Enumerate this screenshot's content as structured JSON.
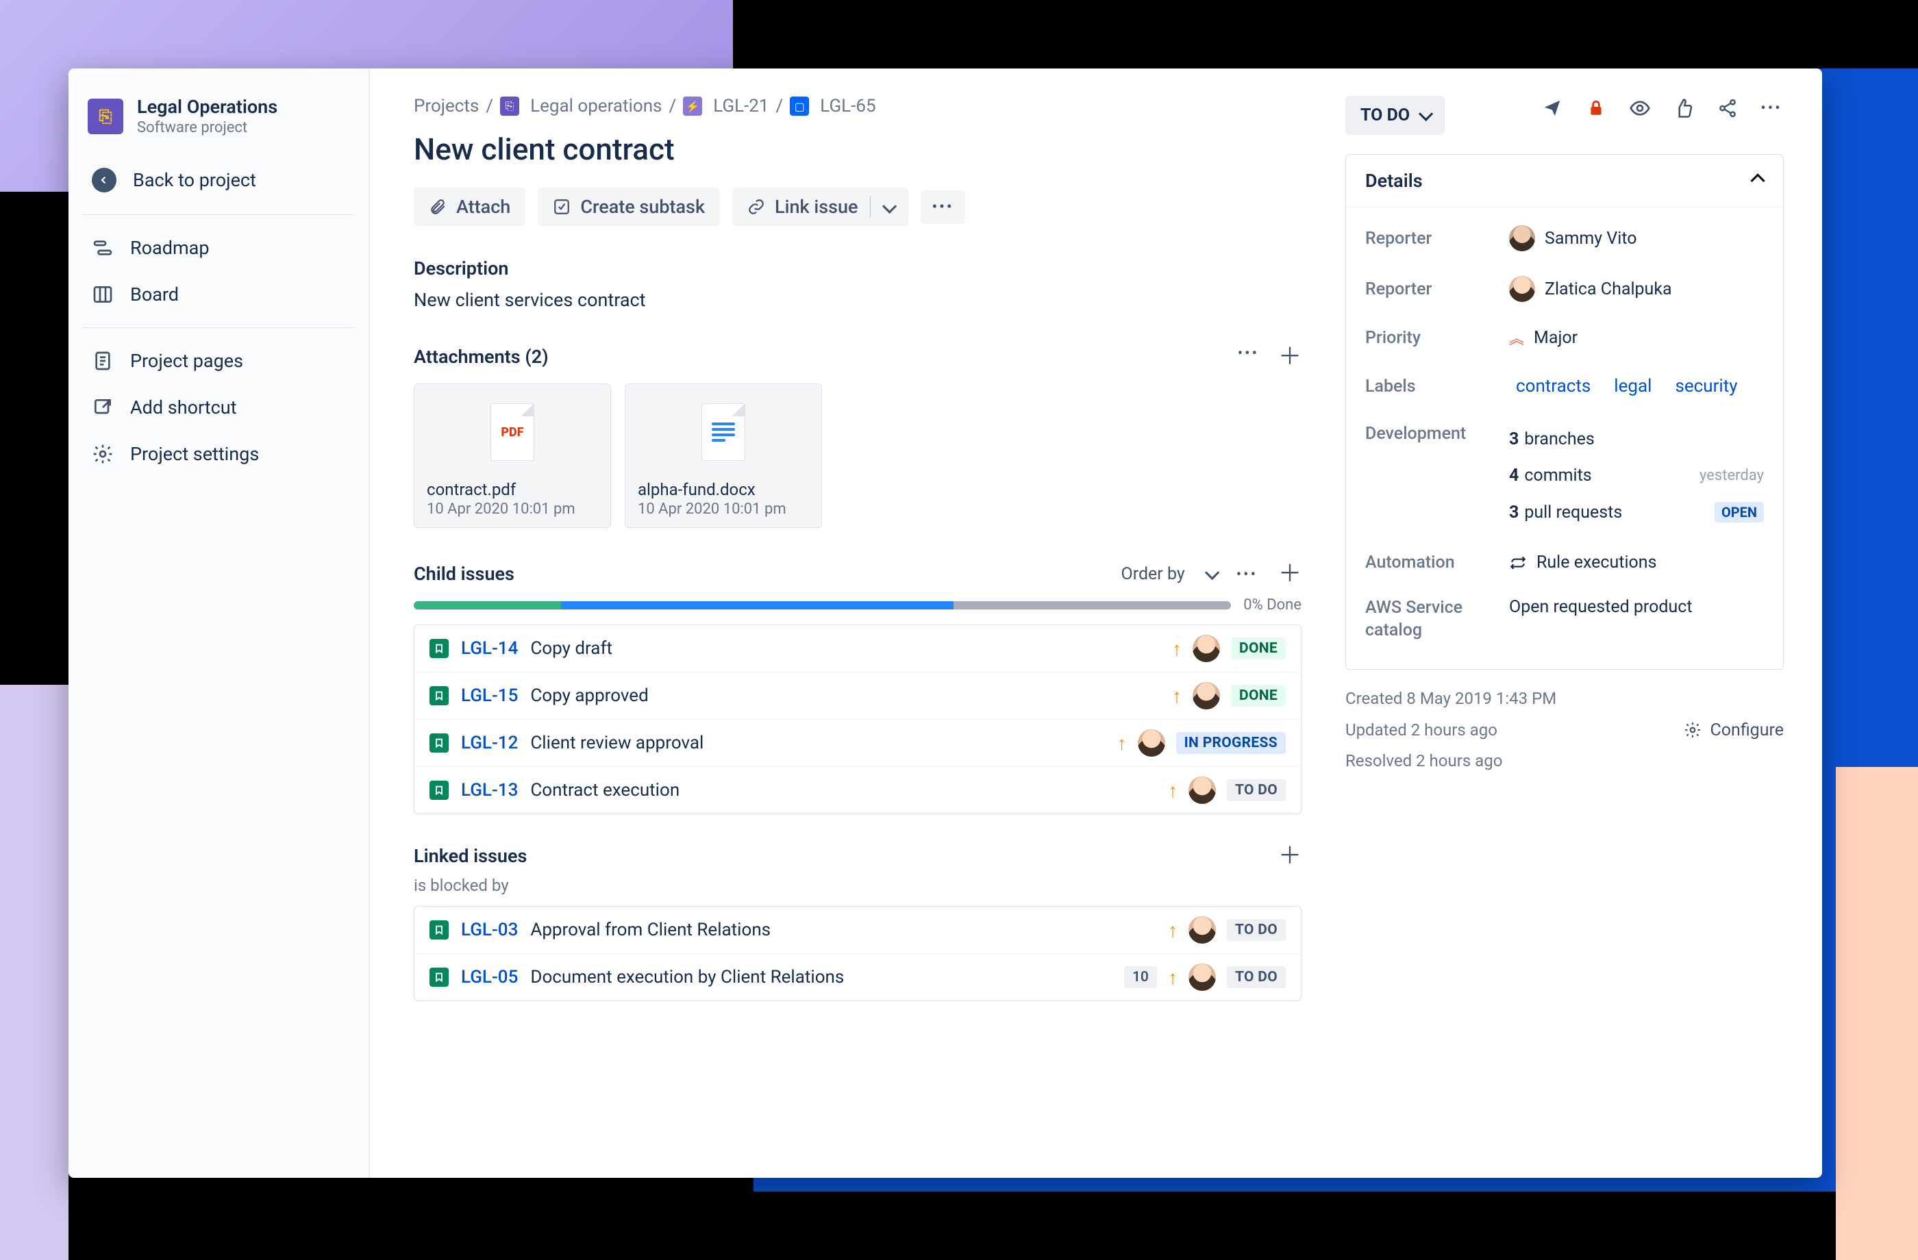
{
  "sidebar": {
    "project_name": "Legal Operations",
    "project_type": "Software project",
    "back_label": "Back to project",
    "nav": [
      {
        "icon": "roadmap-icon",
        "label": "Roadmap"
      },
      {
        "icon": "board-icon",
        "label": "Board"
      }
    ],
    "nav2": [
      {
        "icon": "page-icon",
        "label": "Project pages"
      },
      {
        "icon": "shortcut-icon",
        "label": "Add shortcut"
      },
      {
        "icon": "gear-icon",
        "label": "Project settings"
      }
    ]
  },
  "breadcrumbs": {
    "root": "Projects",
    "project": "Legal operations",
    "epic": "LGL-21",
    "issue": "LGL-65"
  },
  "issue": {
    "title": "New client contract",
    "status": "TO DO"
  },
  "toolbar": {
    "attach": "Attach",
    "create_subtask": "Create subtask",
    "link_issue": "Link issue"
  },
  "description": {
    "heading": "Description",
    "text": "New client services contract"
  },
  "attachments": {
    "heading": "Attachments (2)",
    "items": [
      {
        "kind": "pdf",
        "name": "contract.pdf",
        "date": "10 Apr 2020 10:01 pm"
      },
      {
        "kind": "docx",
        "name": "alpha-fund.docx",
        "date": "10 Apr 2020 10:01 pm"
      }
    ]
  },
  "child_issues": {
    "heading": "Child issues",
    "order_by": "Order by",
    "progress_label": "0% Done",
    "progress": {
      "done_pct": 18,
      "inprog_pct": 48,
      "rest_pct": 34
    },
    "items": [
      {
        "key": "LGL-14",
        "summary": "Copy draft",
        "status": "DONE"
      },
      {
        "key": "LGL-15",
        "summary": "Copy approved",
        "status": "DONE"
      },
      {
        "key": "LGL-12",
        "summary": "Client review approval",
        "status": "IN PROGRESS"
      },
      {
        "key": "LGL-13",
        "summary": "Contract execution",
        "status": "TO DO"
      }
    ]
  },
  "linked": {
    "heading": "Linked issues",
    "relation": "is blocked by",
    "items": [
      {
        "key": "LGL-03",
        "summary": "Approval from Client Relations",
        "status": "TO DO",
        "count": null
      },
      {
        "key": "LGL-05",
        "summary": "Document execution by Client Relations",
        "status": "TO DO",
        "count": "10"
      }
    ]
  },
  "details": {
    "heading": "Details",
    "reporter1_label": "Reporter",
    "reporter1_name": "Sammy Vito",
    "reporter2_label": "Reporter",
    "reporter2_name": "Zlatica Chalpuka",
    "priority_label": "Priority",
    "priority_value": "Major",
    "labels_label": "Labels",
    "labels": [
      "contracts",
      "legal",
      "security"
    ],
    "dev_label": "Development",
    "dev": {
      "branches_n": "3",
      "branches": "branches",
      "commits_n": "4",
      "commits": "commits",
      "commits_when": "yesterday",
      "prs_n": "3",
      "prs": "pull requests",
      "prs_tag": "OPEN"
    },
    "automation_label": "Automation",
    "automation_value": "Rule executions",
    "aws_label": "AWS Service catalog",
    "aws_value": "Open requested product"
  },
  "meta": {
    "created": "Created 8 May 2019 1:43 PM",
    "updated": "Updated 2 hours ago",
    "resolved": "Resolved 2 hours ago",
    "configure": "Configure"
  }
}
